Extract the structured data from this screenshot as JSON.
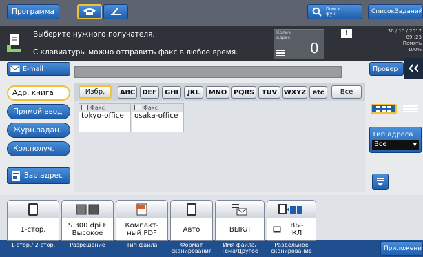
{
  "topbar": {
    "program_label": "Программа",
    "search_label_1": "Поиск",
    "search_label_2": "фун.",
    "job_list_label": "СписокЗаданий"
  },
  "message": {
    "line1": "Выберите нужного получателя.",
    "line2": "С клавиатуры можно отправить факс в любое время.",
    "counter_label_1": "Колич.",
    "counter_label_2": "адрес.",
    "counter_value": "0",
    "warning": "!",
    "date": "30 / 10 / 2017",
    "time": "09 :23",
    "memory_label": "Память",
    "memory_value": "100%"
  },
  "email_button": "E-mail",
  "check_button": "Провер",
  "tabs": {
    "favorites": "Избр.",
    "letters": [
      "ABC",
      "DEF",
      "GHI",
      "JKL",
      "MNO",
      "PQRS",
      "TUV",
      "WXYZ",
      "etc"
    ],
    "all": "Все"
  },
  "cards": [
    {
      "type": "Факс",
      "name": "tokyo-office"
    },
    {
      "type": "Факс",
      "name": "osaka-office"
    }
  ],
  "left_nav": {
    "address_book": "Адр. книга",
    "direct_input": "Прямой ввод",
    "job_log": "Журн.задан.",
    "recipient_count": "Кол.получ.",
    "reg_address": "Зар.адрес"
  },
  "address_type": {
    "label": "Тип адреса",
    "value": "Все"
  },
  "tiles": [
    {
      "value": "1-стор.",
      "label": "1-стор./ 2-стор."
    },
    {
      "value": "S 300 dpi F Высокое",
      "label": "Разрешение"
    },
    {
      "value": "Компакт-ный PDF",
      "label": "Тип файла"
    },
    {
      "value": "Авто",
      "label": "Формат сканирования"
    },
    {
      "value": "ВЫКЛ",
      "label": "Имя файла/ Тема/Другое"
    },
    {
      "value": "ВЫ-КЛ",
      "label": "Раздельное сканирование"
    }
  ],
  "application_button": "Приложение",
  "colors": {
    "accent_blue": "#1f5fae",
    "dark_bar": "#2f3339",
    "highlight_yellow": "#f1c232"
  }
}
